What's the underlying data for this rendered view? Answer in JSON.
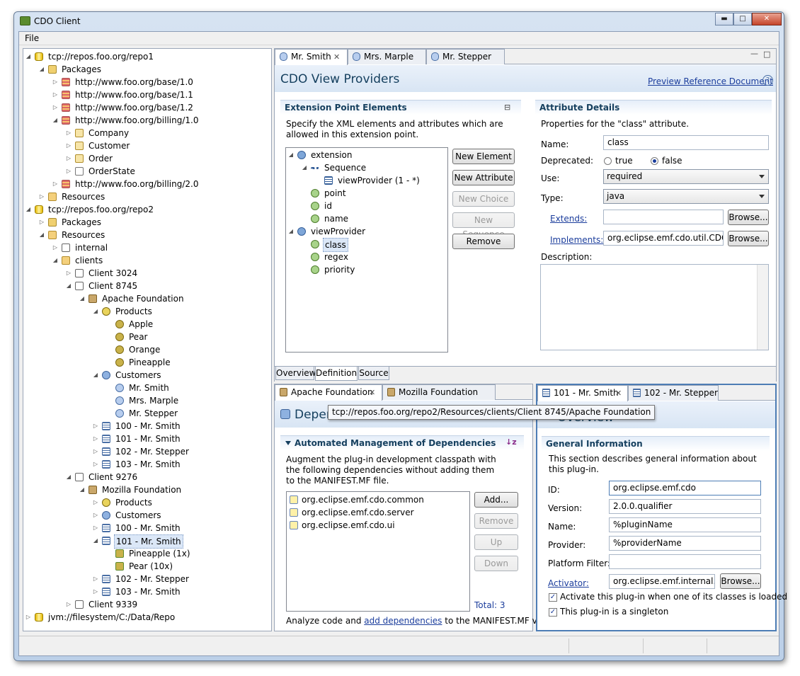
{
  "app_title": "CDO Client",
  "menu": {
    "file": "File"
  },
  "repo_tree": [
    {
      "t": "tcp://repos.foo.org/repo1",
      "ic": "ic-db",
      "d": 0,
      "tw": "open"
    },
    {
      "t": "Packages",
      "ic": "ic-pkgs",
      "d": 1,
      "tw": "open"
    },
    {
      "t": "http://www.foo.org/base/1.0",
      "ic": "ic-pkg",
      "d": 2,
      "tw": "closed"
    },
    {
      "t": "http://www.foo.org/base/1.1",
      "ic": "ic-pkg",
      "d": 2,
      "tw": "closed"
    },
    {
      "t": "http://www.foo.org/base/1.2",
      "ic": "ic-pkg",
      "d": 2,
      "tw": "closed"
    },
    {
      "t": "http://www.foo.org/billing/1.0",
      "ic": "ic-pkg",
      "d": 2,
      "tw": "open"
    },
    {
      "t": "Company",
      "ic": "ic-cls",
      "d": 3,
      "tw": "closed"
    },
    {
      "t": "Customer",
      "ic": "ic-cls",
      "d": 3,
      "tw": "closed"
    },
    {
      "t": "Order",
      "ic": "ic-cls",
      "d": 3,
      "tw": "closed"
    },
    {
      "t": "OrderState",
      "ic": "ic-enum",
      "d": 3,
      "tw": "closed"
    },
    {
      "t": "http://www.foo.org/billing/2.0",
      "ic": "ic-pkg",
      "d": 2,
      "tw": "closed"
    },
    {
      "t": "Resources",
      "ic": "ic-fold",
      "d": 1,
      "tw": "closed"
    },
    {
      "t": "tcp://repos.foo.org/repo2",
      "ic": "ic-db",
      "d": 0,
      "tw": "open"
    },
    {
      "t": "Packages",
      "ic": "ic-pkgs",
      "d": 1,
      "tw": "closed"
    },
    {
      "t": "Resources",
      "ic": "ic-fold",
      "d": 1,
      "tw": "open"
    },
    {
      "t": "internal",
      "ic": "ic-doc",
      "d": 2,
      "tw": "closed"
    },
    {
      "t": "clients",
      "ic": "ic-fold",
      "d": 2,
      "tw": "open"
    },
    {
      "t": "Client 3024",
      "ic": "ic-doc",
      "d": 3,
      "tw": "closed"
    },
    {
      "t": "Client 8745",
      "ic": "ic-doc",
      "d": 3,
      "tw": "open"
    },
    {
      "t": "Apache Foundation",
      "ic": "ic-fact",
      "d": 4,
      "tw": "open"
    },
    {
      "t": "Products",
      "ic": "ic-prods",
      "d": 5,
      "tw": "open"
    },
    {
      "t": "Apple",
      "ic": "ic-prod",
      "d": 6,
      "tw": ""
    },
    {
      "t": "Pear",
      "ic": "ic-prod",
      "d": 6,
      "tw": ""
    },
    {
      "t": "Orange",
      "ic": "ic-prod",
      "d": 6,
      "tw": ""
    },
    {
      "t": "Pineapple",
      "ic": "ic-prod",
      "d": 6,
      "tw": ""
    },
    {
      "t": "Customers",
      "ic": "ic-custs",
      "d": 5,
      "tw": "open"
    },
    {
      "t": "Mr. Smith",
      "ic": "ic-cust",
      "d": 6,
      "tw": ""
    },
    {
      "t": "Mrs. Marple",
      "ic": "ic-cust",
      "d": 6,
      "tw": ""
    },
    {
      "t": "Mr. Stepper",
      "ic": "ic-cust",
      "d": 6,
      "tw": ""
    },
    {
      "t": "100 - Mr. Smith",
      "ic": "ic-ord",
      "d": 5,
      "tw": "closed"
    },
    {
      "t": "101 - Mr. Smith",
      "ic": "ic-ord",
      "d": 5,
      "tw": "closed"
    },
    {
      "t": "102 - Mr. Stepper",
      "ic": "ic-ord",
      "d": 5,
      "tw": "closed"
    },
    {
      "t": "103 - Mr. Smith",
      "ic": "ic-ord",
      "d": 5,
      "tw": "closed"
    },
    {
      "t": "Client 9276",
      "ic": "ic-doc",
      "d": 3,
      "tw": "open"
    },
    {
      "t": "Mozilla Foundation",
      "ic": "ic-fact",
      "d": 4,
      "tw": "open"
    },
    {
      "t": "Products",
      "ic": "ic-prods",
      "d": 5,
      "tw": "closed"
    },
    {
      "t": "Customers",
      "ic": "ic-custs",
      "d": 5,
      "tw": "closed"
    },
    {
      "t": "100 - Mr. Smith",
      "ic": "ic-ord",
      "d": 5,
      "tw": "closed"
    },
    {
      "t": "101 - Mr. Smith",
      "ic": "ic-ord",
      "d": 5,
      "tw": "open",
      "sel": true
    },
    {
      "t": "Pineapple (1x)",
      "ic": "ic-line",
      "d": 6,
      "tw": ""
    },
    {
      "t": "Pear (10x)",
      "ic": "ic-line",
      "d": 6,
      "tw": ""
    },
    {
      "t": "102 - Mr. Stepper",
      "ic": "ic-ord",
      "d": 5,
      "tw": "closed"
    },
    {
      "t": "103 - Mr. Smith",
      "ic": "ic-ord",
      "d": 5,
      "tw": "closed"
    },
    {
      "t": "Client 9339",
      "ic": "ic-doc",
      "d": 3,
      "tw": "closed"
    },
    {
      "t": "jvm://filesystem/C:/Data/Repo",
      "ic": "ic-db",
      "d": 0,
      "tw": "closed"
    }
  ],
  "editor": {
    "tabs": [
      "Mr. Smith",
      "Mrs. Marple",
      "Mr. Stepper"
    ],
    "form_title": "CDO View Providers",
    "preview_link": "Preview Reference Document",
    "ext_section": {
      "title": "Extension Point Elements",
      "desc": "Specify the XML elements and attributes which are allowed in this extension point.",
      "tree": [
        {
          "t": "extension",
          "d": 0,
          "tw": "open",
          "k": "elem"
        },
        {
          "t": "Sequence",
          "d": 1,
          "tw": "open",
          "k": "seq"
        },
        {
          "t": "viewProvider (1 - *)",
          "d": 2,
          "tw": "",
          "k": "ref"
        },
        {
          "t": "point",
          "d": 1,
          "tw": "",
          "k": "attr"
        },
        {
          "t": "id",
          "d": 1,
          "tw": "",
          "k": "attr"
        },
        {
          "t": "name",
          "d": 1,
          "tw": "",
          "k": "attr"
        },
        {
          "t": "viewProvider",
          "d": 0,
          "tw": "open",
          "k": "elem"
        },
        {
          "t": "class",
          "d": 1,
          "tw": "",
          "k": "attr",
          "sel": true
        },
        {
          "t": "regex",
          "d": 1,
          "tw": "",
          "k": "attr"
        },
        {
          "t": "priority",
          "d": 1,
          "tw": "",
          "k": "attr"
        }
      ],
      "buttons": {
        "new_element": "New Element",
        "new_attribute": "New Attribute",
        "new_choice": "New Choice",
        "new_sequence": "New Sequence",
        "remove": "Remove"
      }
    },
    "attr_section": {
      "title": "Attribute Details",
      "desc": "Properties for the \"class\" attribute.",
      "name_label": "Name:",
      "name_value": "class",
      "deprecated_label": "Deprecated:",
      "true_label": "true",
      "false_label": "false",
      "use_label": "Use:",
      "use_value": "required",
      "type_label": "Type:",
      "type_value": "java",
      "extends_label": "Extends:",
      "extends_value": "",
      "implements_label": "Implements:",
      "implements_value": "org.eclipse.emf.cdo.util.CDOVi",
      "browse": "Browse...",
      "description_label": "Description:"
    },
    "bottom_tabs": [
      "Overview",
      "Definition",
      "Source"
    ]
  },
  "deps_editor": {
    "tabs": [
      "Apache Foundation",
      "Mozilla Foundation"
    ],
    "form_title": "Depen",
    "tooltip": "tcp://repos.foo.org/repo2/Resources/clients/Client 8745/Apache Foundation",
    "section_title": "Automated Management of Dependencies",
    "desc": "Augment the plug-in development classpath with the following dependencies without adding them to the MANIFEST.MF file.",
    "items": [
      "org.eclipse.emf.cdo.common",
      "org.eclipse.emf.cdo.server",
      "org.eclipse.emf.cdo.ui"
    ],
    "buttons": {
      "add": "Add...",
      "remove": "Remove",
      "up": "Up",
      "down": "Down"
    },
    "total": "Total: 3",
    "footer_prefix": "Analyze code and ",
    "footer_link": "add dependencies",
    "footer_suffix": " to the MANIFEST.MF via:"
  },
  "overview_editor": {
    "tabs": [
      "101 - Mr. Smith",
      "102 - Mr. Stepper"
    ],
    "form_title": "Overview",
    "section_title": "General Information",
    "desc": "This section describes general information about this plug-in.",
    "id_label": "ID:",
    "id_value": "org.eclipse.emf.cdo",
    "version_label": "Version:",
    "version_value": "2.0.0.qualifier",
    "name_label": "Name:",
    "name_value": "%pluginName",
    "provider_label": "Provider:",
    "provider_value": "%providerName",
    "platform_label": "Platform Filter:",
    "platform_value": "",
    "activator_label": "Activator:",
    "activator_value": "org.eclipse.emf.internal.cdo",
    "browse": "Browse...",
    "check1": "Activate this plug-in when one of its classes is loaded",
    "check2": "This plug-in is a singleton"
  }
}
